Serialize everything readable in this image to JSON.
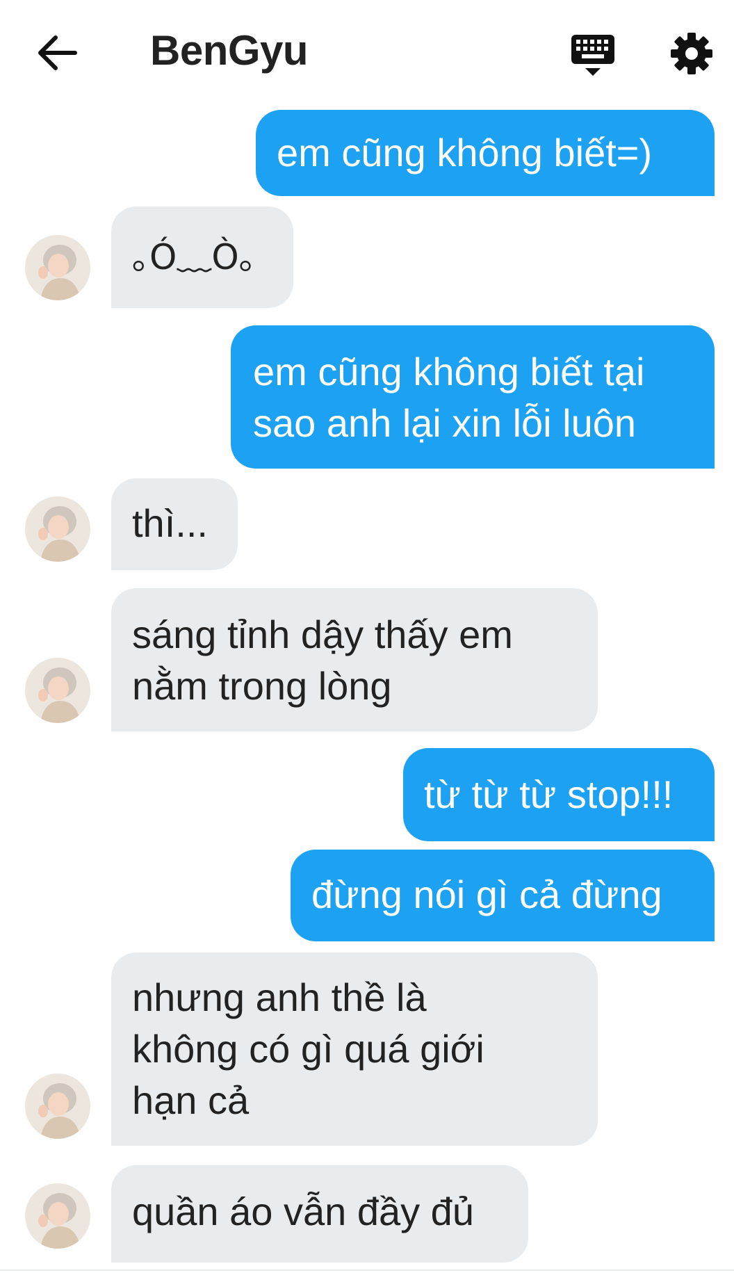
{
  "header": {
    "title": "BenGyu",
    "back_icon": "arrow-left-icon",
    "keyboard_icon": "keyboard-icon",
    "settings_icon": "gear-icon"
  },
  "colors": {
    "outgoing_bubble": "#1da1f2",
    "incoming_bubble": "#e8ecef",
    "text_dark": "#222222"
  },
  "messages": [
    {
      "direction": "out",
      "text": "em cũng không biết=)"
    },
    {
      "direction": "in",
      "text": "｡Ó﹏Ò｡"
    },
    {
      "direction": "out",
      "text": "em cũng không biết tại\nsao anh lại xin lỗi luôn"
    },
    {
      "direction": "in",
      "text": "thì..."
    },
    {
      "direction": "in",
      "text": "sáng tỉnh dậy thấy em\nnằm trong lòng"
    },
    {
      "direction": "out",
      "text": "từ từ từ stop!!!"
    },
    {
      "direction": "out",
      "text": "đừng nói gì cả đừng"
    },
    {
      "direction": "in",
      "text": "nhưng anh thề là\nkhông có gì quá giới\nhạn cả"
    },
    {
      "direction": "in",
      "text": "quần áo vẫn đầy đủ"
    }
  ]
}
